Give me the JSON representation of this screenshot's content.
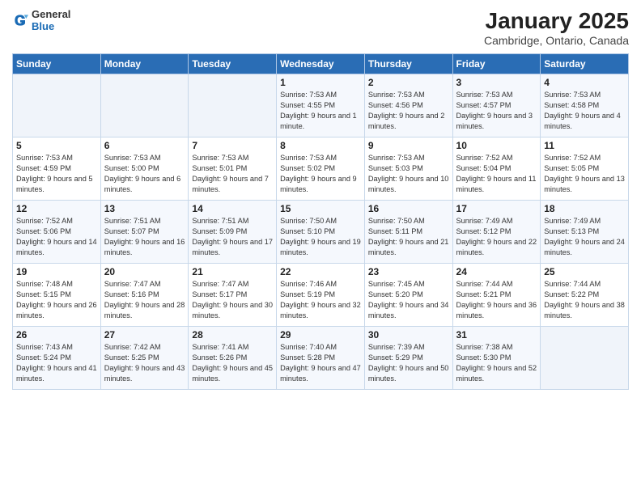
{
  "header": {
    "logo_general": "General",
    "logo_blue": "Blue",
    "month_title": "January 2025",
    "location": "Cambridge, Ontario, Canada"
  },
  "days_of_week": [
    "Sunday",
    "Monday",
    "Tuesday",
    "Wednesday",
    "Thursday",
    "Friday",
    "Saturday"
  ],
  "weeks": [
    [
      {
        "day": "",
        "info": ""
      },
      {
        "day": "",
        "info": ""
      },
      {
        "day": "",
        "info": ""
      },
      {
        "day": "1",
        "info": "Sunrise: 7:53 AM\nSunset: 4:55 PM\nDaylight: 9 hours and 1 minute."
      },
      {
        "day": "2",
        "info": "Sunrise: 7:53 AM\nSunset: 4:56 PM\nDaylight: 9 hours and 2 minutes."
      },
      {
        "day": "3",
        "info": "Sunrise: 7:53 AM\nSunset: 4:57 PM\nDaylight: 9 hours and 3 minutes."
      },
      {
        "day": "4",
        "info": "Sunrise: 7:53 AM\nSunset: 4:58 PM\nDaylight: 9 hours and 4 minutes."
      }
    ],
    [
      {
        "day": "5",
        "info": "Sunrise: 7:53 AM\nSunset: 4:59 PM\nDaylight: 9 hours and 5 minutes."
      },
      {
        "day": "6",
        "info": "Sunrise: 7:53 AM\nSunset: 5:00 PM\nDaylight: 9 hours and 6 minutes."
      },
      {
        "day": "7",
        "info": "Sunrise: 7:53 AM\nSunset: 5:01 PM\nDaylight: 9 hours and 7 minutes."
      },
      {
        "day": "8",
        "info": "Sunrise: 7:53 AM\nSunset: 5:02 PM\nDaylight: 9 hours and 9 minutes."
      },
      {
        "day": "9",
        "info": "Sunrise: 7:53 AM\nSunset: 5:03 PM\nDaylight: 9 hours and 10 minutes."
      },
      {
        "day": "10",
        "info": "Sunrise: 7:52 AM\nSunset: 5:04 PM\nDaylight: 9 hours and 11 minutes."
      },
      {
        "day": "11",
        "info": "Sunrise: 7:52 AM\nSunset: 5:05 PM\nDaylight: 9 hours and 13 minutes."
      }
    ],
    [
      {
        "day": "12",
        "info": "Sunrise: 7:52 AM\nSunset: 5:06 PM\nDaylight: 9 hours and 14 minutes."
      },
      {
        "day": "13",
        "info": "Sunrise: 7:51 AM\nSunset: 5:07 PM\nDaylight: 9 hours and 16 minutes."
      },
      {
        "day": "14",
        "info": "Sunrise: 7:51 AM\nSunset: 5:09 PM\nDaylight: 9 hours and 17 minutes."
      },
      {
        "day": "15",
        "info": "Sunrise: 7:50 AM\nSunset: 5:10 PM\nDaylight: 9 hours and 19 minutes."
      },
      {
        "day": "16",
        "info": "Sunrise: 7:50 AM\nSunset: 5:11 PM\nDaylight: 9 hours and 21 minutes."
      },
      {
        "day": "17",
        "info": "Sunrise: 7:49 AM\nSunset: 5:12 PM\nDaylight: 9 hours and 22 minutes."
      },
      {
        "day": "18",
        "info": "Sunrise: 7:49 AM\nSunset: 5:13 PM\nDaylight: 9 hours and 24 minutes."
      }
    ],
    [
      {
        "day": "19",
        "info": "Sunrise: 7:48 AM\nSunset: 5:15 PM\nDaylight: 9 hours and 26 minutes."
      },
      {
        "day": "20",
        "info": "Sunrise: 7:47 AM\nSunset: 5:16 PM\nDaylight: 9 hours and 28 minutes."
      },
      {
        "day": "21",
        "info": "Sunrise: 7:47 AM\nSunset: 5:17 PM\nDaylight: 9 hours and 30 minutes."
      },
      {
        "day": "22",
        "info": "Sunrise: 7:46 AM\nSunset: 5:19 PM\nDaylight: 9 hours and 32 minutes."
      },
      {
        "day": "23",
        "info": "Sunrise: 7:45 AM\nSunset: 5:20 PM\nDaylight: 9 hours and 34 minutes."
      },
      {
        "day": "24",
        "info": "Sunrise: 7:44 AM\nSunset: 5:21 PM\nDaylight: 9 hours and 36 minutes."
      },
      {
        "day": "25",
        "info": "Sunrise: 7:44 AM\nSunset: 5:22 PM\nDaylight: 9 hours and 38 minutes."
      }
    ],
    [
      {
        "day": "26",
        "info": "Sunrise: 7:43 AM\nSunset: 5:24 PM\nDaylight: 9 hours and 41 minutes."
      },
      {
        "day": "27",
        "info": "Sunrise: 7:42 AM\nSunset: 5:25 PM\nDaylight: 9 hours and 43 minutes."
      },
      {
        "day": "28",
        "info": "Sunrise: 7:41 AM\nSunset: 5:26 PM\nDaylight: 9 hours and 45 minutes."
      },
      {
        "day": "29",
        "info": "Sunrise: 7:40 AM\nSunset: 5:28 PM\nDaylight: 9 hours and 47 minutes."
      },
      {
        "day": "30",
        "info": "Sunrise: 7:39 AM\nSunset: 5:29 PM\nDaylight: 9 hours and 50 minutes."
      },
      {
        "day": "31",
        "info": "Sunrise: 7:38 AM\nSunset: 5:30 PM\nDaylight: 9 hours and 52 minutes."
      },
      {
        "day": "",
        "info": ""
      }
    ]
  ]
}
